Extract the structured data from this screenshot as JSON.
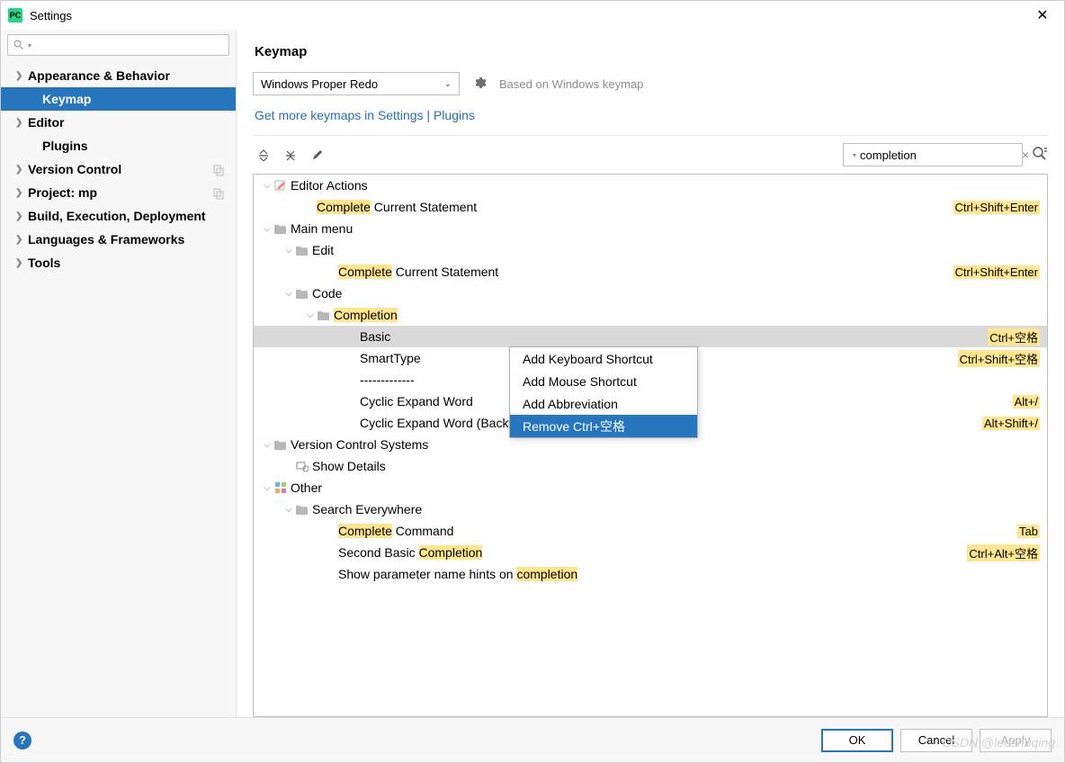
{
  "window": {
    "title": "Settings"
  },
  "sidebar": {
    "items": [
      {
        "label": "Appearance & Behavior",
        "bold": true,
        "chev": true
      },
      {
        "label": "Keymap",
        "bold": true,
        "child": true,
        "selected": true
      },
      {
        "label": "Editor",
        "bold": true,
        "chev": true
      },
      {
        "label": "Plugins",
        "bold": true,
        "child": true
      },
      {
        "label": "Version Control",
        "bold": true,
        "chev": true,
        "copy": true
      },
      {
        "label": "Project: mp",
        "bold": true,
        "chev": true,
        "copy": true
      },
      {
        "label": "Build, Execution, Deployment",
        "bold": true,
        "chev": true
      },
      {
        "label": "Languages & Frameworks",
        "bold": true,
        "chev": true
      },
      {
        "label": "Tools",
        "bold": true,
        "chev": true
      }
    ]
  },
  "content": {
    "heading": "Keymap",
    "keymap_select": "Windows Proper Redo",
    "based_on": "Based on Windows keymap",
    "more_link": "Get more keymaps in Settings | Plugins",
    "search_value": "completion"
  },
  "tree": [
    {
      "indent": 0,
      "tw": "v",
      "icon": "edit",
      "parts": [
        [
          "Editor Actions",
          false
        ]
      ]
    },
    {
      "indent": 2,
      "parts": [
        [
          "Complete",
          true
        ],
        [
          " Current Statement",
          false
        ]
      ],
      "shortcut": "Ctrl+Shift+Enter"
    },
    {
      "indent": 0,
      "tw": "v",
      "icon": "folder",
      "parts": [
        [
          "Main menu",
          false
        ]
      ]
    },
    {
      "indent": 1,
      "tw": "v",
      "icon": "folder",
      "parts": [
        [
          "Edit",
          false
        ]
      ]
    },
    {
      "indent": 3,
      "parts": [
        [
          "Complete",
          true
        ],
        [
          " Current Statement",
          false
        ]
      ],
      "shortcut": "Ctrl+Shift+Enter"
    },
    {
      "indent": 1,
      "tw": "v",
      "icon": "folder",
      "parts": [
        [
          "Code",
          false
        ]
      ]
    },
    {
      "indent": 2,
      "tw": "v",
      "icon": "folder",
      "parts": [
        [
          "Completion",
          true
        ]
      ]
    },
    {
      "indent": 4,
      "parts": [
        [
          "Basic",
          false
        ]
      ],
      "shortcut": "Ctrl+空格",
      "selected": true
    },
    {
      "indent": 4,
      "parts": [
        [
          "SmartType",
          false
        ]
      ],
      "shortcut": "Ctrl+Shift+空格"
    },
    {
      "indent": 4,
      "parts": [
        [
          "-------------",
          false
        ]
      ]
    },
    {
      "indent": 4,
      "parts": [
        [
          "Cyclic Expand Word",
          false
        ]
      ],
      "shortcut": "Alt+/"
    },
    {
      "indent": 4,
      "parts": [
        [
          "Cyclic Expand Word (Backward)",
          false
        ]
      ],
      "shortcut": "Alt+Shift+/"
    },
    {
      "indent": 0,
      "tw": "v",
      "icon": "folder",
      "parts": [
        [
          "Version Control Systems",
          false
        ]
      ]
    },
    {
      "indent": 1,
      "icon": "show",
      "parts": [
        [
          "Show Details",
          false
        ]
      ]
    },
    {
      "indent": 0,
      "tw": "v",
      "icon": "other",
      "parts": [
        [
          "Other",
          false
        ]
      ]
    },
    {
      "indent": 1,
      "tw": "v",
      "icon": "folder",
      "parts": [
        [
          "Search Everywhere",
          false
        ]
      ]
    },
    {
      "indent": 3,
      "parts": [
        [
          "Complete",
          true
        ],
        [
          " Command",
          false
        ]
      ],
      "shortcut": "Tab"
    },
    {
      "indent": 3,
      "parts": [
        [
          "Second Basic ",
          false
        ],
        [
          "Completion",
          true
        ]
      ],
      "shortcut": "Ctrl+Alt+空格"
    },
    {
      "indent": 3,
      "parts": [
        [
          "Show parameter name hints on ",
          false
        ],
        [
          "completion",
          true
        ]
      ]
    }
  ],
  "context_menu": {
    "items": [
      {
        "label": "Add Keyboard Shortcut"
      },
      {
        "label": "Add Mouse Shortcut"
      },
      {
        "label": "Add Abbreviation"
      },
      {
        "label": "Remove Ctrl+空格",
        "selected": true
      }
    ]
  },
  "buttons": {
    "ok": "OK",
    "cancel": "Cancel",
    "apply": "Apply"
  },
  "watermark": "CSDN @leeshuqing"
}
